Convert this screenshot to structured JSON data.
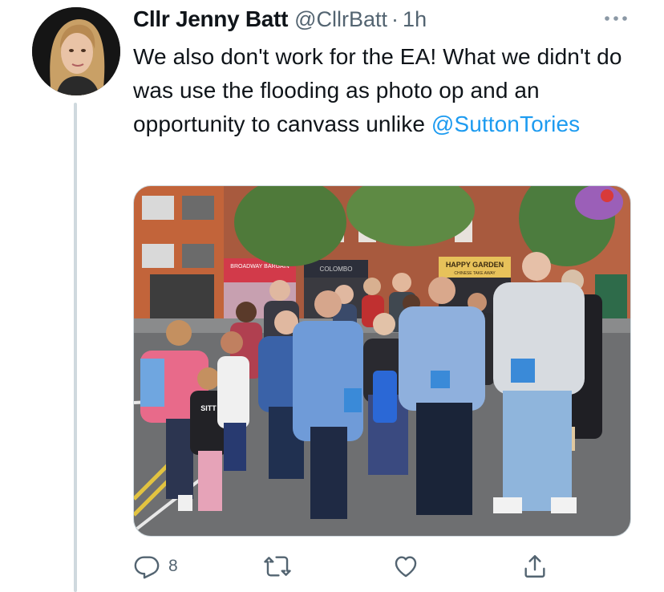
{
  "tweet": {
    "display_name": "Cllr Jenny Batt",
    "handle": "@CllrBatt",
    "separator": "·",
    "time": "1h",
    "text_before_mention": "We also don't work for the EA! What we didn't do was use the flooding as photo op and an opportunity to canvass unlike ",
    "mention": "@SuttonTories",
    "more_icon": "more-horizontal-icon"
  },
  "media": {
    "shop_signs": {
      "left": "BROADWAY BARGAIN",
      "middle": "COLOMBO",
      "right": "HAPPY GARDEN",
      "right_sub": "CHINESE TAKE AWAY"
    },
    "child_shirt_text": "SITT"
  },
  "actions": {
    "reply": {
      "icon": "reply-icon",
      "count": "8"
    },
    "retweet": {
      "icon": "retweet-icon",
      "count": ""
    },
    "like": {
      "icon": "heart-icon",
      "count": ""
    },
    "share": {
      "icon": "share-icon",
      "count": ""
    }
  },
  "colors": {
    "accent": "#1d9bf0",
    "secondary_text": "#536471",
    "thread_line": "#cfd9de"
  }
}
